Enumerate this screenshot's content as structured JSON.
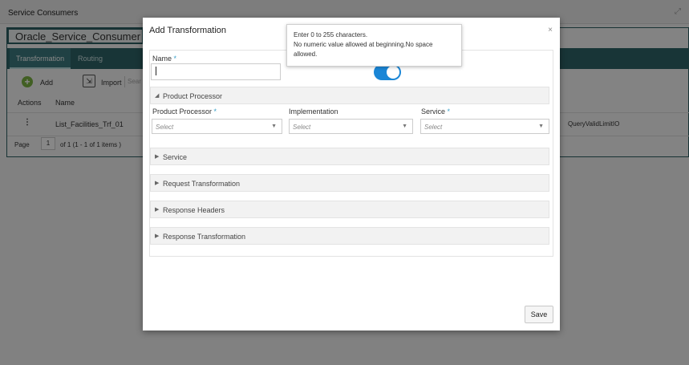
{
  "background": {
    "title": "Service Consumers",
    "consumer_name": "Oracle_Service_Consumer",
    "tabs": [
      "Transformation",
      "Routing"
    ],
    "toolbar": {
      "add_label": "Add",
      "import_label": "Import",
      "search_placeholder": "Sear"
    },
    "table_headers": [
      "Actions",
      "Name"
    ],
    "row": {
      "actions": "⋮",
      "name": "List_Facilities_Trf_01",
      "right_value": "QueryValidLimitIO"
    },
    "pager": {
      "page_label": "Page",
      "page_number": "1",
      "of_label": "of 1  (1 - 1 of 1 items )"
    }
  },
  "modal": {
    "title": "Add Transformation",
    "close_glyph": "×",
    "name_label": "Name",
    "required_mark": "*",
    "name_value": "",
    "toggle_on": true,
    "sections": {
      "product_processor": "Product Processor",
      "service": "Service",
      "request_transformation": "Request Transformation",
      "response_headers": "Response Headers",
      "response_transformation": "Response Transformation"
    },
    "fields": {
      "product_processor_label": "Product Processor",
      "implementation_label": "Implementation",
      "service_label": "Service",
      "select_placeholder": "Select"
    },
    "save_label": "Save"
  },
  "tooltip": {
    "line1": "Enter 0 to 255 characters.",
    "line2": "No numeric value allowed at beginning.No space",
    "line3": "allowed."
  },
  "colors": {
    "accent": "#2e6569",
    "toggle": "#1a86d6",
    "required": "#3aa0c9"
  }
}
